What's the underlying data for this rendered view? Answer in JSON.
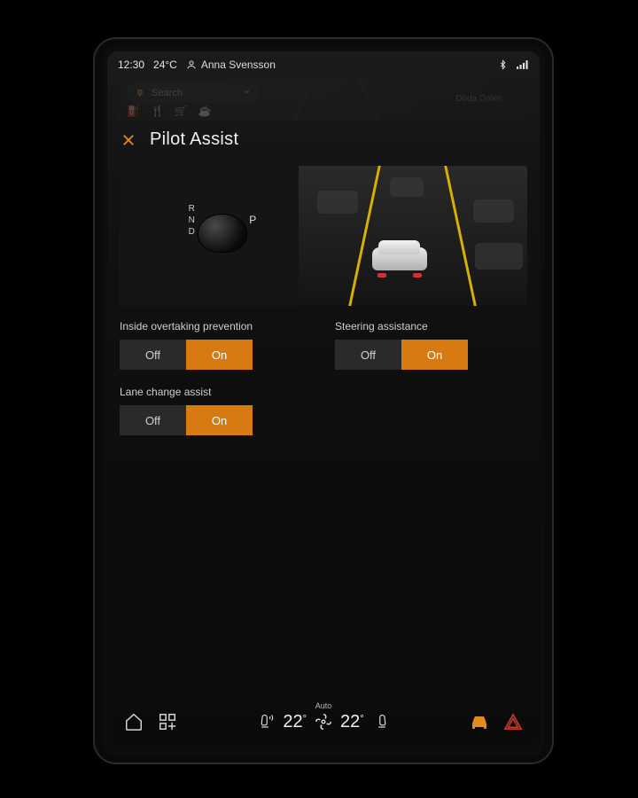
{
  "status": {
    "time": "12:30",
    "outside_temp": "24°C",
    "profile_name": "Anna Svensson"
  },
  "map_strip": {
    "search_placeholder": "Search",
    "poi_label": "Döda Dalen"
  },
  "page": {
    "title": "Pilot Assist"
  },
  "gear": {
    "r": "R",
    "n": "N",
    "d": "D",
    "p": "P"
  },
  "settings": {
    "inside_overtaking_prevention": {
      "label": "Inside overtaking prevention",
      "off": "Off",
      "on": "On",
      "value": "On"
    },
    "steering_assistance": {
      "label": "Steering assistance",
      "off": "Off",
      "on": "On",
      "value": "On"
    },
    "lane_change_assist": {
      "label": "Lane change assist",
      "off": "Off",
      "on": "On",
      "value": "On"
    }
  },
  "dock": {
    "climate_mode": "Auto",
    "left_temp": "22",
    "right_temp": "22",
    "degree": "°"
  }
}
